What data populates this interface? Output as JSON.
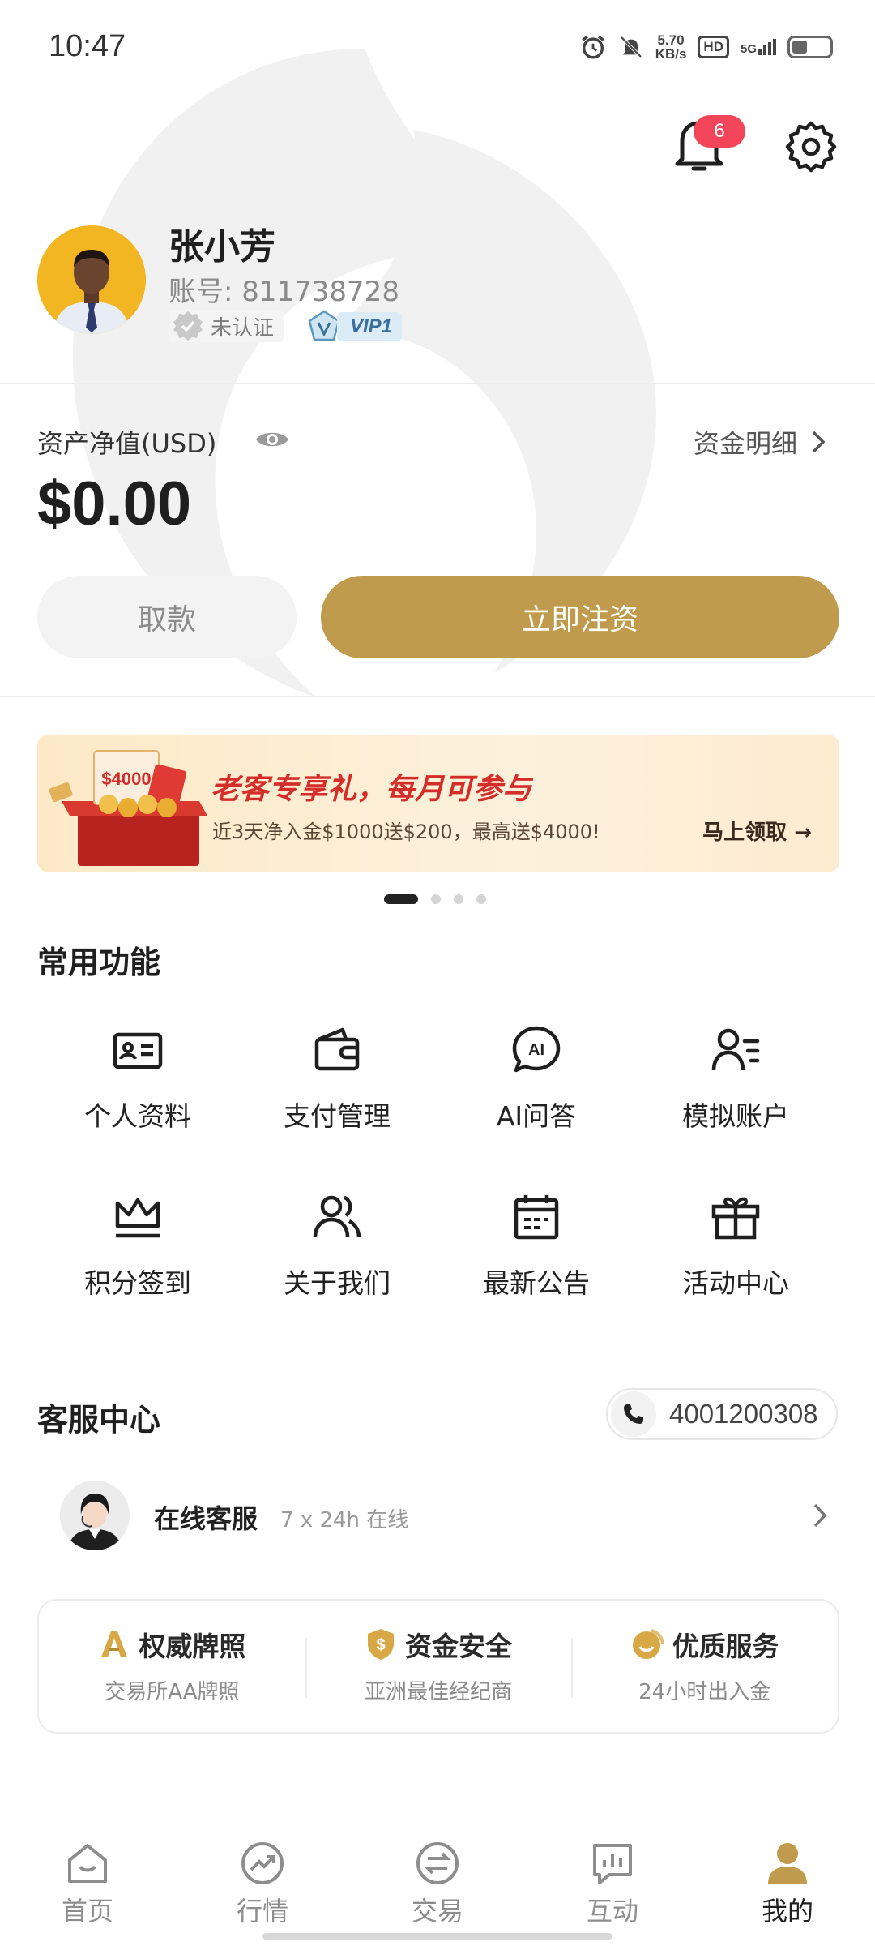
{
  "status_bar": {
    "time": "10:47",
    "net_speed": "5.70",
    "net_unit": "KB/s",
    "hd": "HD",
    "network": "5G",
    "battery_level": 0.35
  },
  "header": {
    "notification_count": "6"
  },
  "profile": {
    "name": "张小芳",
    "account": "账号: 811738728",
    "verify_status": "未认证",
    "vip_level": "VIP1"
  },
  "assets": {
    "label": "资产净值(USD)",
    "value": "$0.00",
    "detail_link": "资金明细",
    "withdraw_label": "取款",
    "deposit_label": "立即注资"
  },
  "banner": {
    "title": "老客专享礼，每月可参与",
    "subtitle": "近3天净入金$1000送$200，最高送$4000!",
    "cta": "马上领取 →",
    "gift_amount": "$4000",
    "active_slide": 1,
    "slide_count": 4
  },
  "functions": {
    "title": "常用功能",
    "items": [
      {
        "label": "个人资料",
        "icon": "id-card-icon"
      },
      {
        "label": "支付管理",
        "icon": "wallet-icon"
      },
      {
        "label": "AI问答",
        "icon": "ai-chat-icon"
      },
      {
        "label": "模拟账户",
        "icon": "user-list-icon"
      },
      {
        "label": "积分签到",
        "icon": "crown-icon"
      },
      {
        "label": "关于我们",
        "icon": "users-icon"
      },
      {
        "label": "最新公告",
        "icon": "calendar-icon"
      },
      {
        "label": "活动中心",
        "icon": "gift-icon"
      }
    ]
  },
  "service": {
    "title": "客服中心",
    "phone": "4001200308",
    "online_title": "在线客服",
    "online_sub": "7 x 24h 在线"
  },
  "trust": [
    {
      "title": "权威牌照",
      "sub": "交易所AA牌照",
      "icon": "license-a-icon"
    },
    {
      "title": "资金安全",
      "sub": "亚洲最佳经纪商",
      "icon": "shield-dollar-icon"
    },
    {
      "title": "优质服务",
      "sub": "24小时出入金",
      "icon": "smile-service-icon"
    }
  ],
  "nav": [
    {
      "label": "首页",
      "icon": "home-icon"
    },
    {
      "label": "行情",
      "icon": "market-icon"
    },
    {
      "label": "交易",
      "icon": "trade-icon"
    },
    {
      "label": "互动",
      "icon": "chat-chart-icon"
    },
    {
      "label": "我的",
      "icon": "profile-icon"
    }
  ],
  "colors": {
    "gold": "#c19b4d",
    "badge_red": "#f2455a",
    "banner_red": "#d42d2a"
  }
}
